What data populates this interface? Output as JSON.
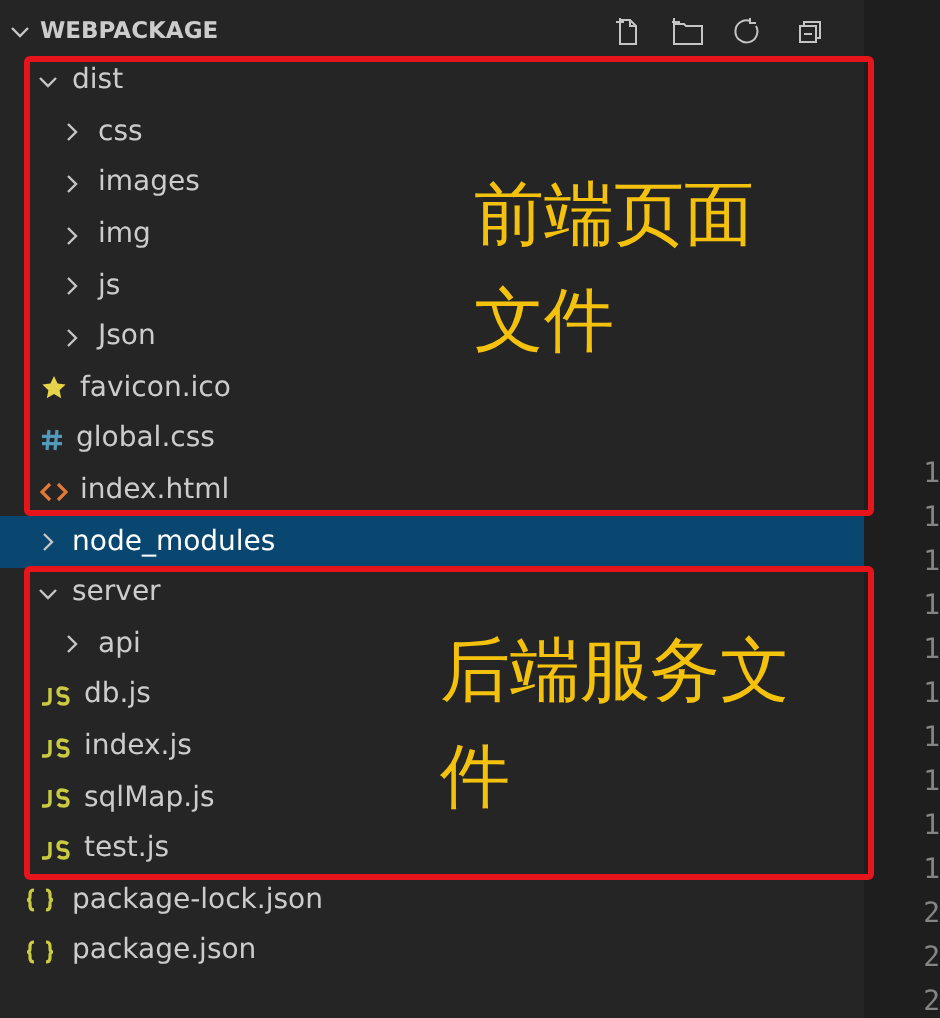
{
  "explorer": {
    "title": "WEBPACKAGE",
    "expanded": true,
    "tree": [
      {
        "label": "dist",
        "kind": "folder",
        "expanded": true,
        "selected": false,
        "children": [
          {
            "label": "css",
            "kind": "folder",
            "expanded": false,
            "selected": false
          },
          {
            "label": "images",
            "kind": "folder",
            "expanded": false,
            "selected": false
          },
          {
            "label": "img",
            "kind": "folder",
            "expanded": false,
            "selected": false
          },
          {
            "label": "js",
            "kind": "folder",
            "expanded": false,
            "selected": false
          },
          {
            "label": "Json",
            "kind": "folder",
            "expanded": false,
            "selected": false
          },
          {
            "label": "favicon.ico",
            "kind": "ico",
            "selected": false
          },
          {
            "label": "global.css",
            "kind": "css",
            "selected": false
          },
          {
            "label": "index.html",
            "kind": "html",
            "selected": false
          }
        ]
      },
      {
        "label": "node_modules",
        "kind": "folder",
        "expanded": false,
        "selected": true
      },
      {
        "label": "server",
        "kind": "folder",
        "expanded": true,
        "selected": false,
        "children": [
          {
            "label": "api",
            "kind": "folder",
            "expanded": false,
            "selected": false
          },
          {
            "label": "db.js",
            "kind": "js",
            "selected": false
          },
          {
            "label": "index.js",
            "kind": "js",
            "selected": false
          },
          {
            "label": "sqlMap.js",
            "kind": "js",
            "selected": false
          },
          {
            "label": "test.js",
            "kind": "js",
            "selected": false
          }
        ]
      },
      {
        "label": "package-lock.json",
        "kind": "json",
        "selected": false
      },
      {
        "label": "package.json",
        "kind": "json",
        "selected": false
      }
    ]
  },
  "annotations": [
    {
      "text": "前端页面文件"
    },
    {
      "text": "后端服务文件"
    }
  ],
  "gutter": [
    "1",
    "1",
    "1",
    "1",
    "1",
    "1",
    "1",
    "1",
    "1",
    "1",
    "2",
    "2",
    "2"
  ]
}
